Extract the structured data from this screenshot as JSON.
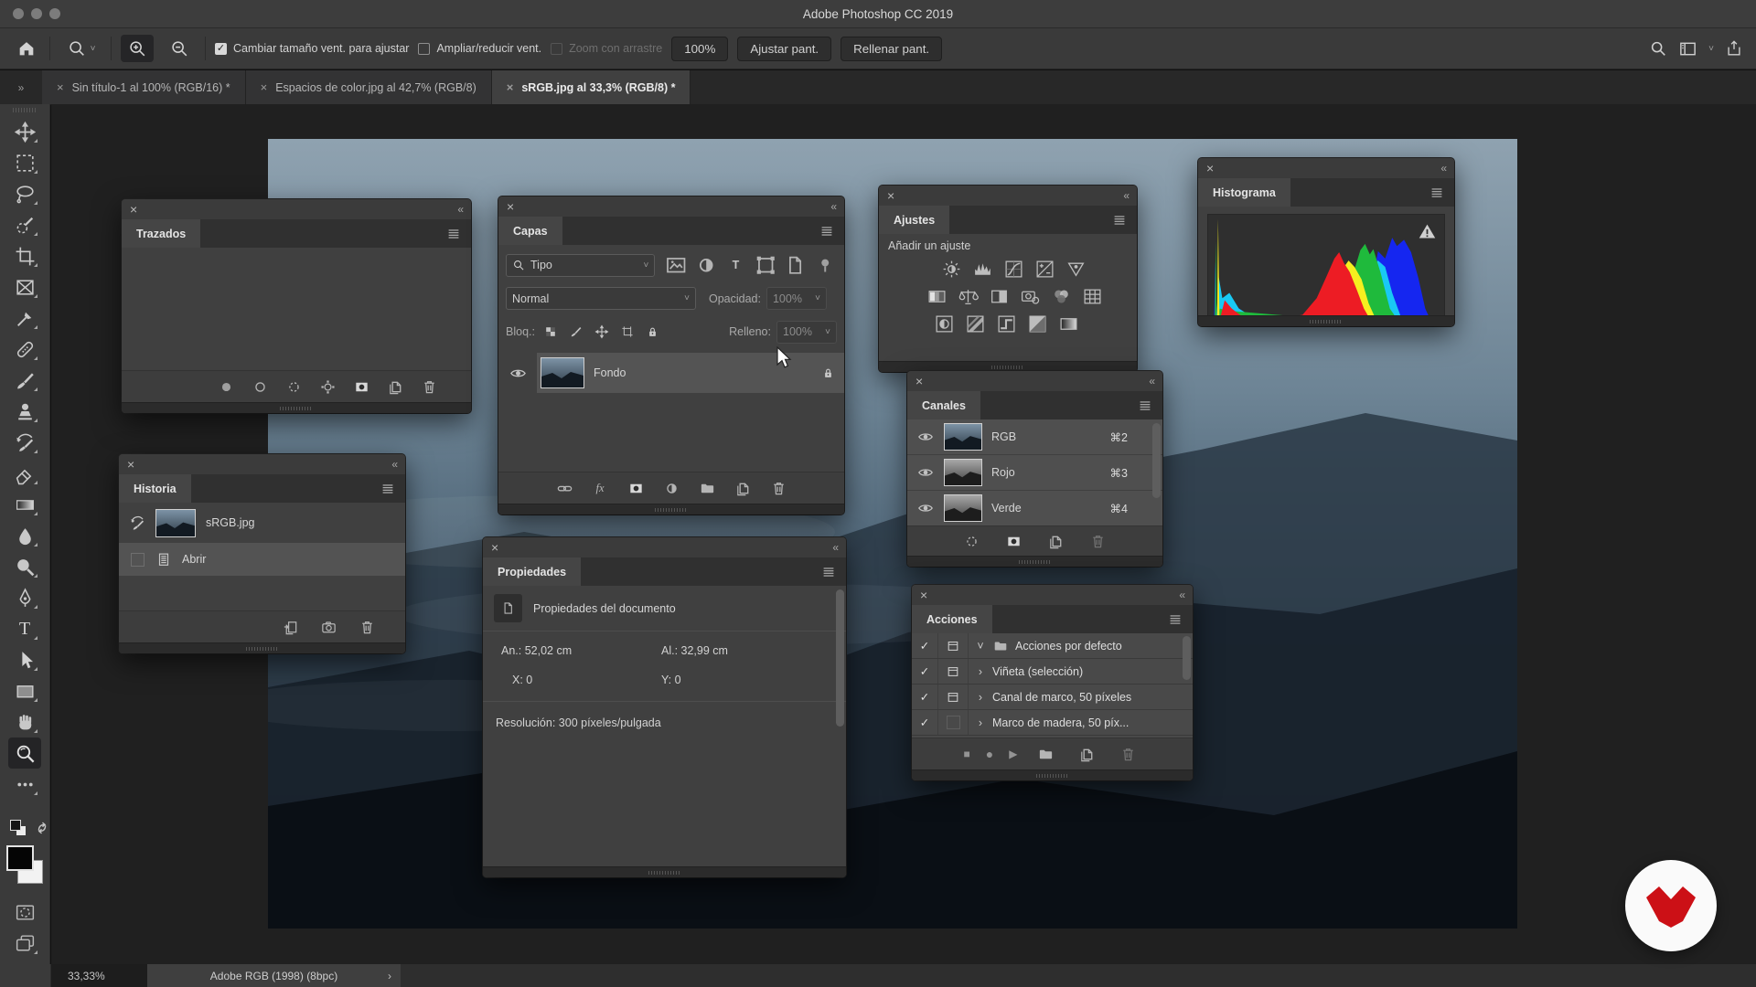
{
  "window": {
    "title": "Adobe Photoshop CC 2019"
  },
  "glyphs": {
    "close": "×",
    "collapse": "«",
    "overflow": "»",
    "chevron_down": "˅",
    "chevron_right": "›",
    "check": "✓",
    "stop": "■",
    "record": "●",
    "play": "▶",
    "fx": "fx",
    "type_T": "T",
    "ellipsis": "",
    "warning": "!"
  },
  "options_bar": {
    "resize_windows_label": "Cambiar tamaño vent. para ajustar",
    "zoom_all_windows_label": "Ampliar/reducir vent.",
    "scrubby_zoom_label": "Zoom con arrastre",
    "zoom_100_label": "100%",
    "fit_screen_label": "Ajustar pant.",
    "fill_screen_label": "Rellenar pant."
  },
  "tabs": [
    {
      "label": "Sin título-1 al 100% (RGB/16) *",
      "active": false
    },
    {
      "label": "Espacios de color.jpg al 42,7% (RGB/8)",
      "active": false
    },
    {
      "label": "sRGB.jpg al 33,3% (RGB/8) *",
      "active": true
    }
  ],
  "panels": {
    "trazados": {
      "title": "Trazados"
    },
    "capas": {
      "title": "Capas",
      "filter_value": "Tipo",
      "blend_mode": "Normal",
      "opacity_label": "Opacidad:",
      "opacity_value": "100%",
      "lock_label": "Bloq.:",
      "fill_label": "Relleno:",
      "fill_value": "100%",
      "layer_name": "Fondo"
    },
    "historia": {
      "title": "Historia",
      "doc_name": "sRGB.jpg",
      "state_1": "Abrir"
    },
    "propiedades": {
      "title": "Propiedades",
      "heading": "Propiedades del documento",
      "width_text": "An.:  52,02 cm",
      "height_text": "Al.:  32,99 cm",
      "x_text": "X:  0",
      "y_text": "Y:  0",
      "resolution_text": "Resolución: 300 píxeles/pulgada"
    },
    "ajustes": {
      "title": "Ajustes",
      "heading": "Añadir un ajuste"
    },
    "canales": {
      "title": "Canales",
      "channels": [
        {
          "name": "RGB",
          "shortcut": "⌘2"
        },
        {
          "name": "Rojo",
          "shortcut": "⌘3"
        },
        {
          "name": "Verde",
          "shortcut": "⌘4"
        }
      ]
    },
    "histograma": {
      "title": "Histograma"
    },
    "acciones": {
      "title": "Acciones",
      "rows": [
        {
          "label": "Acciones por defecto"
        },
        {
          "label": "Viñeta (selección)"
        },
        {
          "label": "Canal de marco, 50 píxeles"
        },
        {
          "label": "Marco de madera, 50 píx..."
        }
      ]
    }
  },
  "status_bar": {
    "zoom": "33,33%",
    "profile": "Adobe RGB (1998) (8bpc)"
  },
  "histogram": {
    "mode": "RGB colors",
    "layers": [
      {
        "color": "#1526f0",
        "points": [
          [
            0,
            1
          ],
          [
            0.025,
            1
          ],
          [
            0.03,
            0.45
          ],
          [
            0.035,
            1
          ],
          [
            0.06,
            0.85
          ],
          [
            0.09,
            0.8
          ],
          [
            0.12,
            0.88
          ],
          [
            0.16,
            0.95
          ],
          [
            0.22,
            1
          ],
          [
            0.66,
            1
          ],
          [
            0.69,
            0.7
          ],
          [
            0.72,
            0.35
          ],
          [
            0.75,
            0.42
          ],
          [
            0.78,
            0.22
          ],
          [
            0.8,
            0.3
          ],
          [
            0.83,
            0.24
          ],
          [
            0.86,
            0.36
          ],
          [
            0.89,
            0.6
          ],
          [
            0.92,
            0.9
          ],
          [
            0.94,
            1
          ],
          [
            1,
            1
          ]
        ]
      },
      {
        "color": "#19c9f4",
        "points": [
          [
            0,
            1
          ],
          [
            0.035,
            1
          ],
          [
            0.045,
            0.6
          ],
          [
            0.06,
            0.8
          ],
          [
            0.09,
            0.75
          ],
          [
            0.13,
            0.9
          ],
          [
            0.18,
            0.97
          ],
          [
            0.25,
            1
          ],
          [
            0.6,
            1
          ],
          [
            0.65,
            0.8
          ],
          [
            0.69,
            0.5
          ],
          [
            0.72,
            0.44
          ],
          [
            0.75,
            0.5
          ],
          [
            0.78,
            0.75
          ],
          [
            0.82,
            1
          ],
          [
            1,
            1
          ]
        ]
      },
      {
        "color": "#1fba3c",
        "points": [
          [
            0,
            1
          ],
          [
            0.028,
            1
          ],
          [
            0.032,
            0.25
          ],
          [
            0.036,
            1
          ],
          [
            0.05,
            0.9
          ],
          [
            0.08,
            0.92
          ],
          [
            0.5,
            1
          ],
          [
            0.57,
            0.88
          ],
          [
            0.61,
            0.6
          ],
          [
            0.645,
            0.34
          ],
          [
            0.665,
            0.28
          ],
          [
            0.685,
            0.38
          ],
          [
            0.7,
            0.33
          ],
          [
            0.73,
            0.55
          ],
          [
            0.77,
            0.9
          ],
          [
            0.8,
            1
          ],
          [
            1,
            1
          ]
        ]
      },
      {
        "color": "#f6ef1f",
        "points": [
          [
            0,
            1
          ],
          [
            0.038,
            1
          ],
          [
            0.042,
            0.04
          ],
          [
            0.048,
            1
          ],
          [
            0.4,
            1
          ],
          [
            0.48,
            0.9
          ],
          [
            0.53,
            0.68
          ],
          [
            0.57,
            0.52
          ],
          [
            0.595,
            0.44
          ],
          [
            0.62,
            0.5
          ],
          [
            0.65,
            0.62
          ],
          [
            0.68,
            0.85
          ],
          [
            0.71,
            1
          ],
          [
            1,
            1
          ]
        ]
      },
      {
        "color": "#ed1c24",
        "points": [
          [
            0,
            1
          ],
          [
            0.05,
            1
          ],
          [
            0.07,
            0.82
          ],
          [
            0.1,
            0.9
          ],
          [
            0.14,
            0.97
          ],
          [
            0.3,
            1
          ],
          [
            0.4,
            0.96
          ],
          [
            0.46,
            0.8
          ],
          [
            0.5,
            0.6
          ],
          [
            0.535,
            0.42
          ],
          [
            0.555,
            0.36
          ],
          [
            0.575,
            0.46
          ],
          [
            0.6,
            0.55
          ],
          [
            0.63,
            0.72
          ],
          [
            0.66,
            0.9
          ],
          [
            0.685,
            1
          ],
          [
            1,
            1
          ]
        ]
      }
    ]
  }
}
